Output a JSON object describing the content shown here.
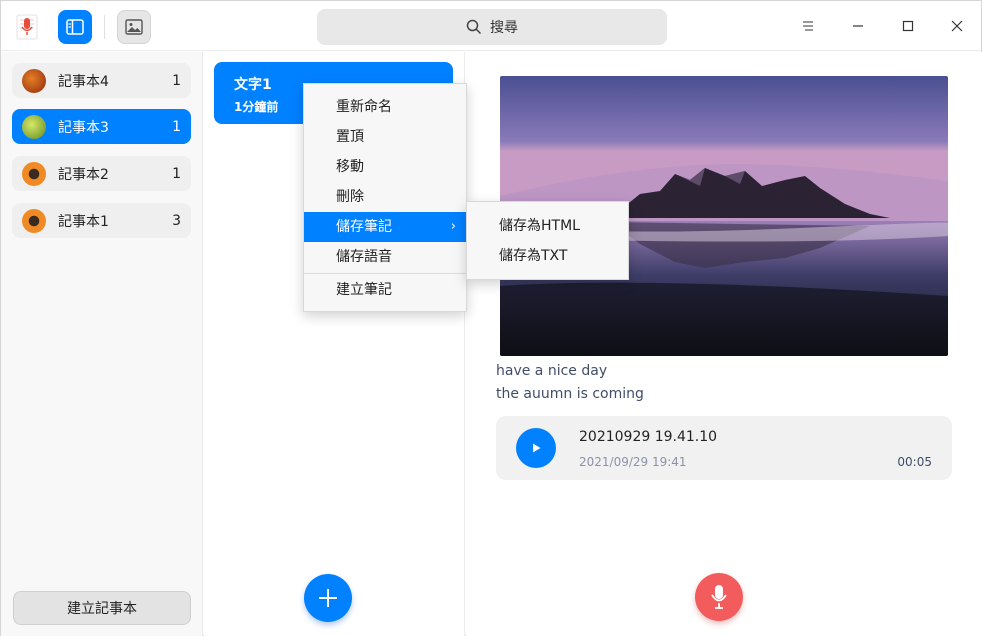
{
  "search": {
    "label": "搜尋"
  },
  "notebooks": [
    {
      "name": "記事本4",
      "count": "1",
      "color": "#c0392b"
    },
    {
      "name": "記事本3",
      "count": "1",
      "color": "#8fbf3a"
    },
    {
      "name": "記事本2",
      "count": "1",
      "color": "#e67e22"
    },
    {
      "name": "記事本1",
      "count": "3",
      "color": "#e67e22"
    }
  ],
  "new_notebook_label": "建立記事本",
  "note": {
    "title": "文字1",
    "time": "1分鐘前"
  },
  "content": {
    "lines": [
      "have a nice day",
      "the auumn is coming"
    ],
    "voice": {
      "title": "20210929 19.41.10",
      "date": "2021/09/29 19:41",
      "duration": "00:05"
    }
  },
  "context_menu": {
    "items": [
      "重新命名",
      "置頂",
      "移動",
      "刪除",
      "儲存筆記",
      "儲存語音",
      "建立筆記"
    ]
  },
  "submenu": {
    "items": [
      "儲存為HTML",
      "儲存為TXT"
    ]
  },
  "colors": {
    "accent": "#0081ff",
    "record": "#f25c5c"
  }
}
